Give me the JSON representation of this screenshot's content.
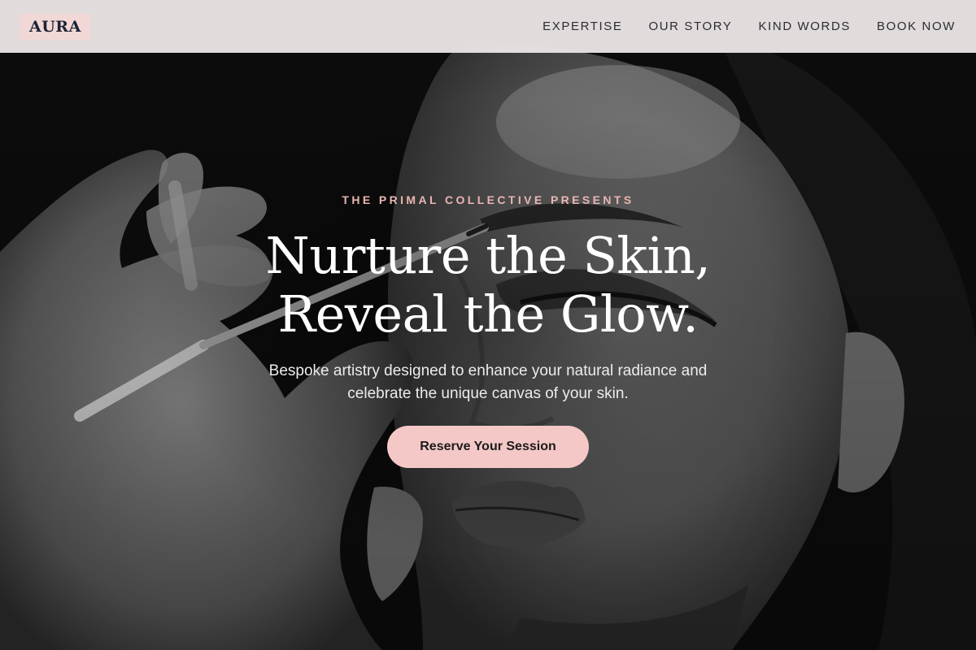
{
  "brand": {
    "logo_text": "AURA"
  },
  "nav": {
    "items": [
      {
        "label": "EXPERTISE"
      },
      {
        "label": "OUR STORY"
      },
      {
        "label": "KIND WORDS"
      },
      {
        "label": "BOOK NOW"
      }
    ]
  },
  "hero": {
    "eyebrow": "THE PRIMAL COLLECTIVE PRESENTS",
    "headline_line1": "Nurture the Skin,",
    "headline_line2": "Reveal the Glow.",
    "subtext_line1": "Bespoke artistry designed to enhance your natural radiance and",
    "subtext_line2": "celebrate the unique canvas of your skin.",
    "cta_label": "Reserve Your Session",
    "image_description_icon": "makeup-artist-photo"
  },
  "colors": {
    "accent_pink": "#f4c8c6",
    "eyebrow_pink": "#e9b6b2",
    "logo_bg": "#f1d8d6",
    "nav_bg": "#e8e2e2",
    "text_dark": "#1c2236"
  }
}
